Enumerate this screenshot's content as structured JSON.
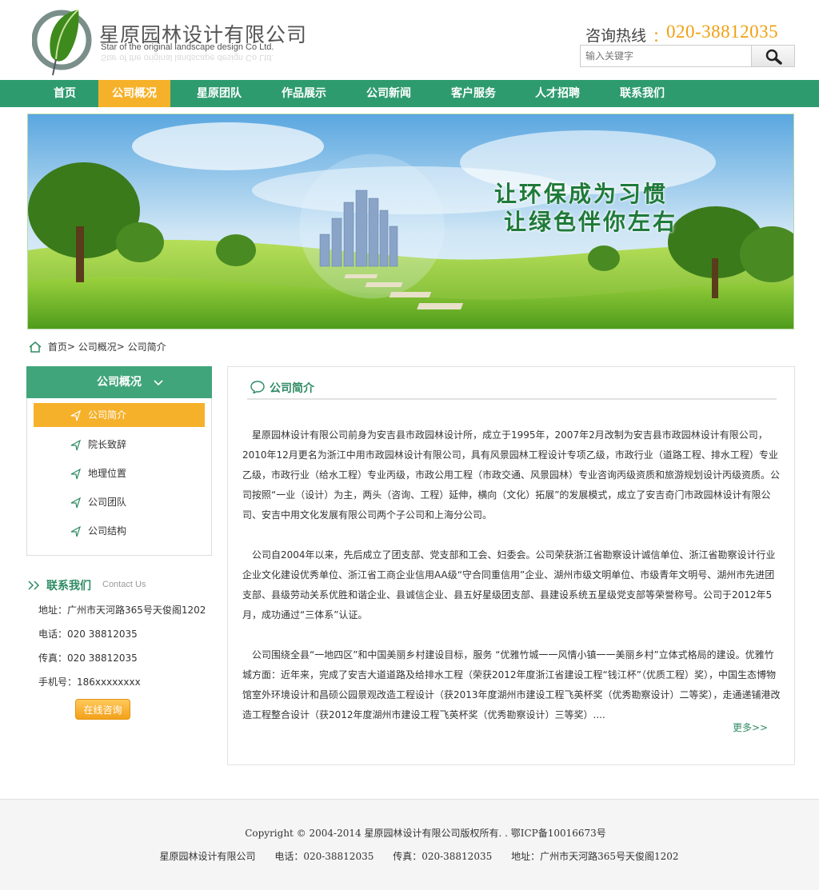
{
  "header": {
    "company_cn": "星原园林设计有限公司",
    "company_en": "Star of the original landscape design Co Ltd.",
    "hotline_label": "咨询热线",
    "hotline_colon": "：",
    "hotline_number": "020-38812035",
    "search_placeholder": "输入关键字"
  },
  "nav": {
    "items": [
      "首页",
      "公司概况",
      "星原团队",
      "作品展示",
      "公司新闻",
      "客户服务",
      "人才招聘",
      "联系我们"
    ],
    "active_index": 1
  },
  "banner": {
    "slogan_line1": "让环保成为习惯",
    "slogan_line2": "让绿色伴你左右"
  },
  "breadcrumb": {
    "items": [
      "首页",
      "公司概况",
      "公司简介"
    ],
    "separator": ">"
  },
  "sidebar": {
    "title": "公司概况",
    "items": [
      "公司简介",
      "院长致辞",
      "地理位置",
      "公司团队",
      "公司结构"
    ],
    "active_index": 0,
    "contact": {
      "title": "联系我们",
      "subtitle": "Contact Us",
      "address": "地址：广州市天河路365号天俊阁1202",
      "phone": "电话：020 38812035",
      "fax": "传真：020 38812035",
      "mobile": "手机号：186xxxxxxxx",
      "online_button": "在线咨询"
    }
  },
  "main": {
    "title": "公司简介",
    "paragraphs": [
      "星原园林设计有限公司前身为安吉县市政园林设计所，成立于1995年，2007年2月改制为安吉县市政园林设计有限公司，2010年12月更名为浙江中用市政园林设计有限公司，具有风景园林工程设计专项乙级，市政行业（道路工程、排水工程）专业乙级，市政行业（给水工程）专业丙级，市政公用工程（市政交通、风景园林）专业咨询丙级资质和旅游规划设计丙级资质。公司按照“一业（设计）为主，两头（咨询、工程）延伸，横向（文化）拓展”的发展模式，成立了安吉奇门市政园林设计有限公司、安吉中用文化发展有限公司两个子公司和上海分公司。",
      "公司自2004年以来，先后成立了团支部、党支部和工会、妇委会。公司荣获浙江省勘察设计诚信单位、浙江省勘察设计行业企业文化建设优秀单位、浙江省工商企业信用AA级“守合同重信用”企业、湖州市级文明单位、市级青年文明号、湖州市先进团支部、县级劳动关系优胜和谐企业、县诚信企业、县五好星级团支部、县建设系统五星级党支部等荣誉称号。公司于2012年5月，成功通过“三体系”认证。",
      "公司围绕全县“一地四区”和中国美丽乡村建设目标，服务 “优雅竹城一一风情小镇一一美丽乡村”立体式格局的建设。优雅竹城方面：近年来，完成了安吉大道道路及给排水工程（荣获2012年度浙江省建设工程“钱江杯”（优质工程）奖），中国生态博物馆室外环境设计和昌硕公园景观改造工程设计（获2013年度湖州市建设工程飞英杯奖（优秀勘察设计）二等奖），走通递铺港改造工程整合设计（获2012年度湖州市建设工程飞英杯奖（优秀勘察设计）三等奖）...."
    ],
    "more": "更多>>"
  },
  "footer": {
    "copyright": "Copyright © 2004-2014  星原园林设计有限公司版权所有. .   鄂ICP备10016673号",
    "company": "星原园林设计有限公司",
    "phone": "电话：020-38812035",
    "fax": "传真：020-38812035",
    "address": "地址：广州市天河路365号天俊阁1202"
  },
  "colors": {
    "brand_green": "#2e9b6f",
    "accent_orange": "#f6b12a",
    "hotline_orange": "#f0a010"
  }
}
